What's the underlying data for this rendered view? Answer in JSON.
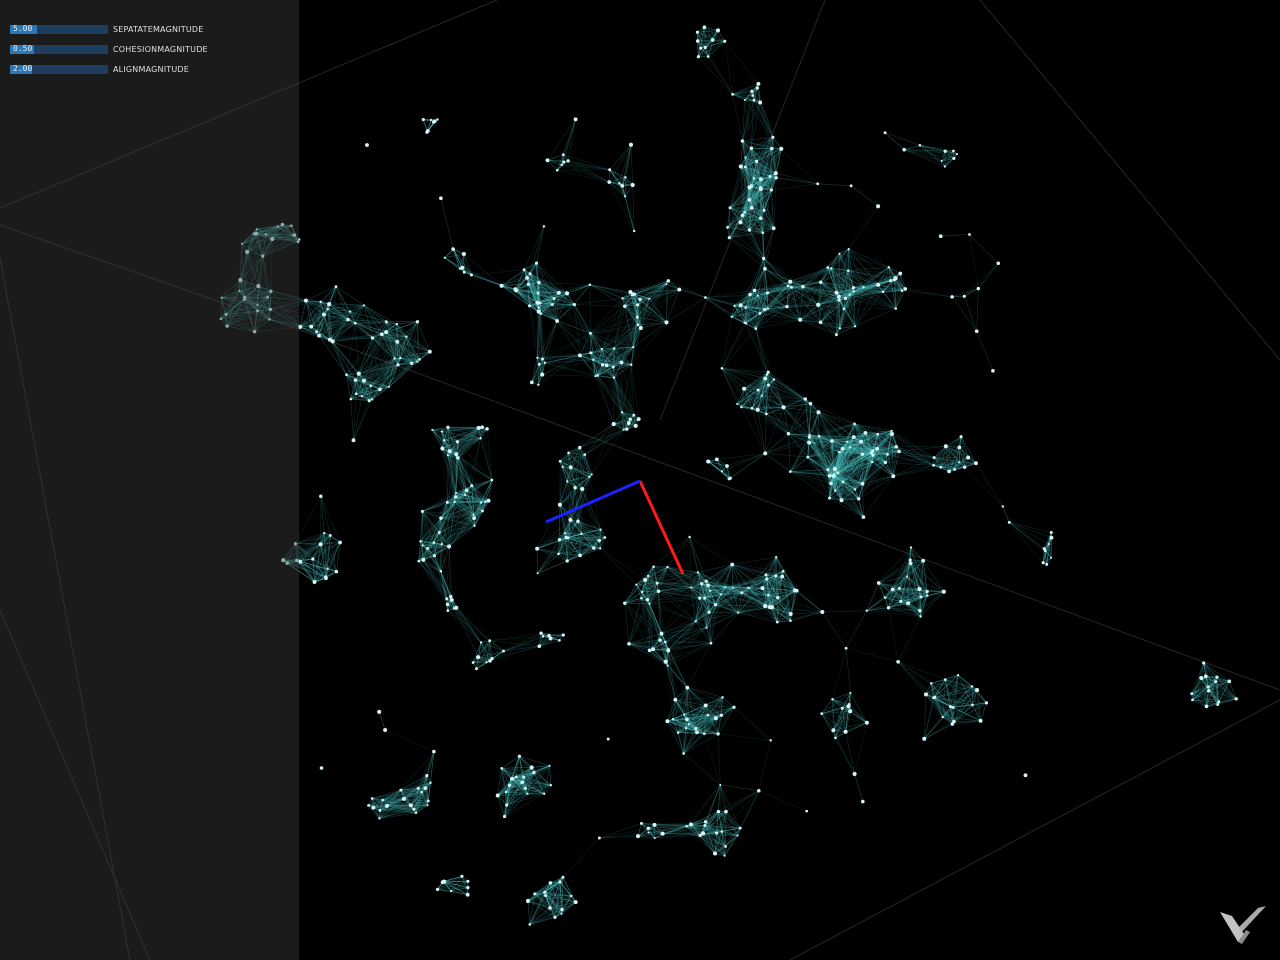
{
  "gui": {
    "sliders": [
      {
        "value_text": "5.00",
        "label": "SEPATATEMAGNITUDE",
        "fraction": 0.28
      },
      {
        "value_text": "0.50",
        "label": "COHESIONMAGNITUDE",
        "fraction": 0.25
      },
      {
        "value_text": "2.00",
        "label": "ALIGNMAGNITUDE",
        "fraction": 0.22
      }
    ]
  },
  "scene": {
    "background": "#000000",
    "particle_color": "#d8f4f4",
    "link_color": "#4ec8c8",
    "axis_x_color": "#ff1a1a",
    "axis_z_color": "#1a22ff",
    "wireframe_color": "#2a2a2a"
  },
  "logo": {
    "icon": "app-logo-icon"
  }
}
